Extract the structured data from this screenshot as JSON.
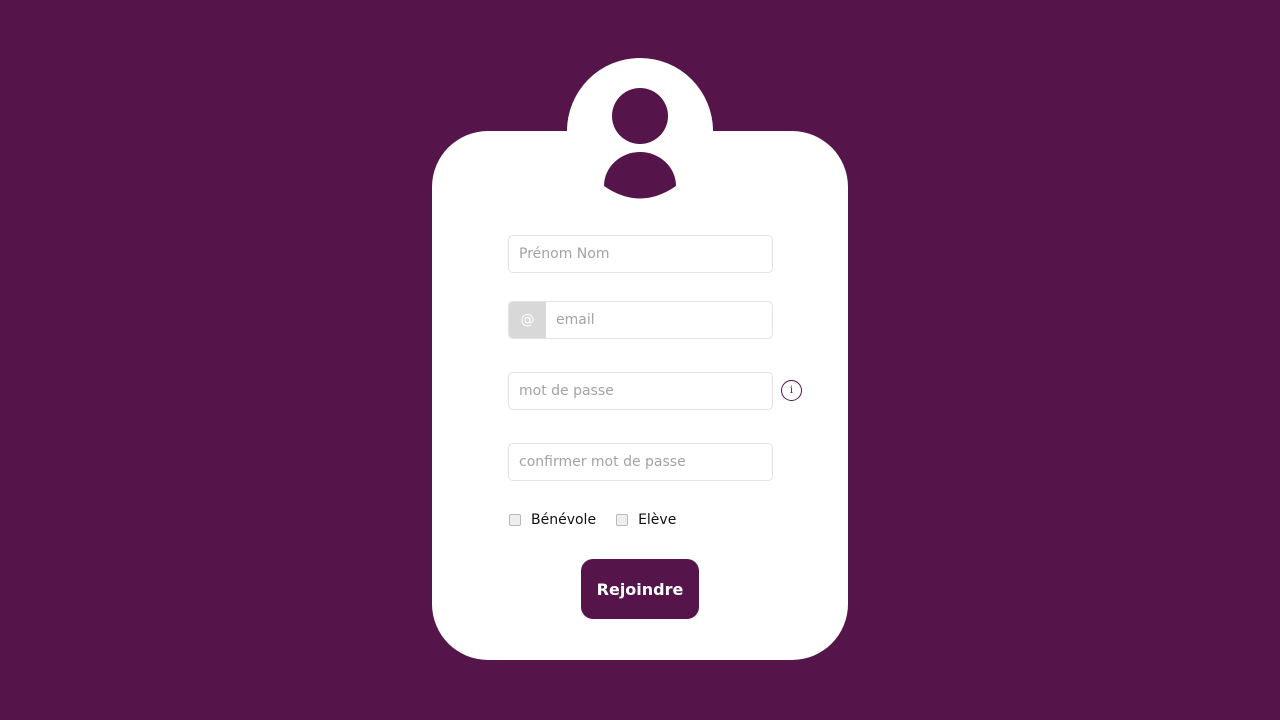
{
  "form": {
    "name_placeholder": "Prénom Nom",
    "email_prefix": "@",
    "email_placeholder": "email",
    "password_placeholder": "mot de passe",
    "password_info_glyph": "i",
    "confirm_placeholder": "confirmer mot de passe",
    "roles": [
      {
        "label": "Bénévole",
        "checked": false
      },
      {
        "label": "Elève",
        "checked": false
      }
    ],
    "submit_label": "Rejoindre"
  },
  "colors": {
    "background": "#55154b",
    "card": "#ffffff",
    "accent": "#55154b",
    "input_border": "#e3e3e3",
    "prefix_bg": "#d8d8d8"
  },
  "icons": {
    "avatar": "user-avatar-icon",
    "info": "info-circle-icon",
    "email_prefix": "at-sign"
  }
}
